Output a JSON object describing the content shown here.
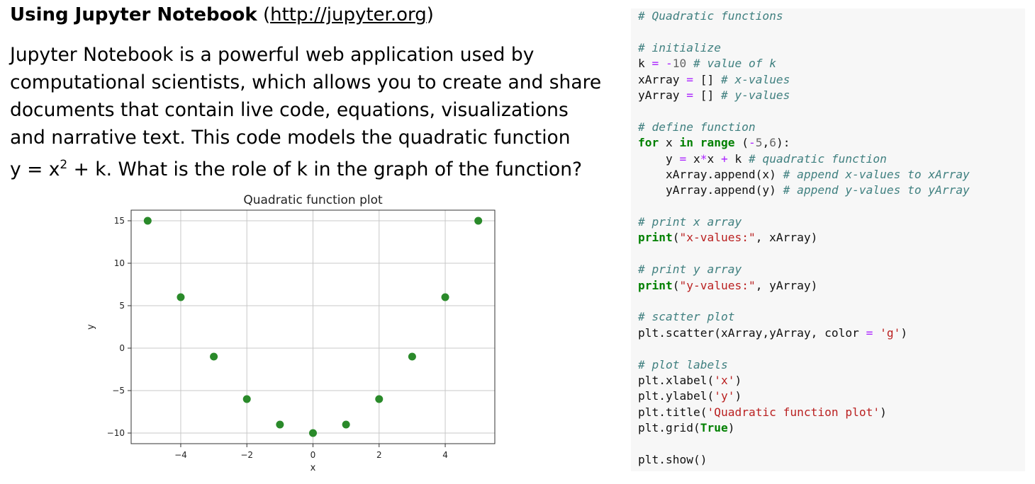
{
  "heading": {
    "title": "Using Jupyter Notebook",
    "link_open": "(",
    "link": "http://jupyter.org",
    "link_close": ")"
  },
  "question": {
    "lines": [
      "Jupyter Notebook is a powerful web application used by",
      "computational scientists, which allows you to create and share",
      "documents that contain live code, equations, visualizations",
      "and narrative text. This code models the quadratic function"
    ],
    "last_line_pre": "y = x",
    "last_line_sup": "2",
    "last_line_post": " + k. What is the role of k in the graph of the function?"
  },
  "chart_data": {
    "type": "scatter",
    "title": "Quadratic function plot",
    "xlabel": "x",
    "ylabel": "y",
    "x": [
      -5,
      -4,
      -3,
      -2,
      -1,
      0,
      1,
      2,
      3,
      4,
      5
    ],
    "y": [
      15,
      6,
      -1,
      -6,
      -9,
      -10,
      -9,
      -6,
      -1,
      6,
      15
    ],
    "xlim": [
      -5.5,
      5.5
    ],
    "ylim": [
      -11.25,
      16.25
    ],
    "xticks": [
      -4,
      -2,
      0,
      2,
      4
    ],
    "xtick_labels": [
      "−4",
      "−2",
      "0",
      "2",
      "4"
    ],
    "yticks": [
      -10,
      -5,
      0,
      5,
      10,
      15
    ],
    "ytick_labels": [
      "−10",
      "−5",
      "0",
      "5",
      "10",
      "15"
    ],
    "grid": true,
    "color": "#2a8a2a"
  },
  "code": {
    "lines": [
      [
        [
          "c",
          "# Quadratic functions"
        ]
      ],
      [],
      [
        [
          "c",
          "# initialize"
        ]
      ],
      [
        [
          "n",
          "k "
        ],
        [
          "o",
          "="
        ],
        [
          "n",
          " "
        ],
        [
          "o",
          "-"
        ],
        [
          "num",
          "10"
        ],
        [
          "n",
          " "
        ],
        [
          "c",
          "# value of k"
        ]
      ],
      [
        [
          "n",
          "xArray "
        ],
        [
          "o",
          "="
        ],
        [
          "n",
          " [] "
        ],
        [
          "c",
          "# x-values"
        ]
      ],
      [
        [
          "n",
          "yArray "
        ],
        [
          "o",
          "="
        ],
        [
          "n",
          " [] "
        ],
        [
          "c",
          "# y-values"
        ]
      ],
      [],
      [
        [
          "c",
          "# define function"
        ]
      ],
      [
        [
          "k",
          "for"
        ],
        [
          "n",
          " x "
        ],
        [
          "k",
          "in"
        ],
        [
          "n",
          " "
        ],
        [
          "k",
          "range"
        ],
        [
          "n",
          " ("
        ],
        [
          "o",
          "-"
        ],
        [
          "num",
          "5"
        ],
        [
          "n",
          ","
        ],
        [
          "num",
          "6"
        ],
        [
          "n",
          "):"
        ]
      ],
      [
        [
          "n",
          "    y "
        ],
        [
          "o",
          "="
        ],
        [
          "n",
          " x"
        ],
        [
          "o",
          "*"
        ],
        [
          "n",
          "x "
        ],
        [
          "o",
          "+"
        ],
        [
          "n",
          " k "
        ],
        [
          "c",
          "# quadratic function"
        ]
      ],
      [
        [
          "n",
          "    xArray.append(x) "
        ],
        [
          "c",
          "# append x-values to xArray"
        ]
      ],
      [
        [
          "n",
          "    yArray.append(y) "
        ],
        [
          "c",
          "# append y-values to yArray"
        ]
      ],
      [],
      [
        [
          "c",
          "# print x array"
        ]
      ],
      [
        [
          "k",
          "print"
        ],
        [
          "n",
          "("
        ],
        [
          "s",
          "\"x-values:\""
        ],
        [
          "n",
          ", xArray)"
        ]
      ],
      [],
      [
        [
          "c",
          "# print y array"
        ]
      ],
      [
        [
          "k",
          "print"
        ],
        [
          "n",
          "("
        ],
        [
          "s",
          "\"y-values:\""
        ],
        [
          "n",
          ", yArray)"
        ]
      ],
      [],
      [
        [
          "c",
          "# scatter plot"
        ]
      ],
      [
        [
          "n",
          "plt.scatter(xArray,yArray, color "
        ],
        [
          "o",
          "="
        ],
        [
          "n",
          " "
        ],
        [
          "s",
          "'g'"
        ],
        [
          "n",
          ")"
        ]
      ],
      [],
      [
        [
          "c",
          "# plot labels"
        ]
      ],
      [
        [
          "n",
          "plt.xlabel("
        ],
        [
          "s",
          "'x'"
        ],
        [
          "n",
          ")"
        ]
      ],
      [
        [
          "n",
          "plt.ylabel("
        ],
        [
          "s",
          "'y'"
        ],
        [
          "n",
          ")"
        ]
      ],
      [
        [
          "n",
          "plt.title("
        ],
        [
          "s",
          "'Quadratic function plot'"
        ],
        [
          "n",
          ")"
        ]
      ],
      [
        [
          "n",
          "plt.grid("
        ],
        [
          "k",
          "True"
        ],
        [
          "n",
          ")"
        ]
      ],
      [],
      [
        [
          "n",
          "plt.show()"
        ]
      ]
    ]
  }
}
